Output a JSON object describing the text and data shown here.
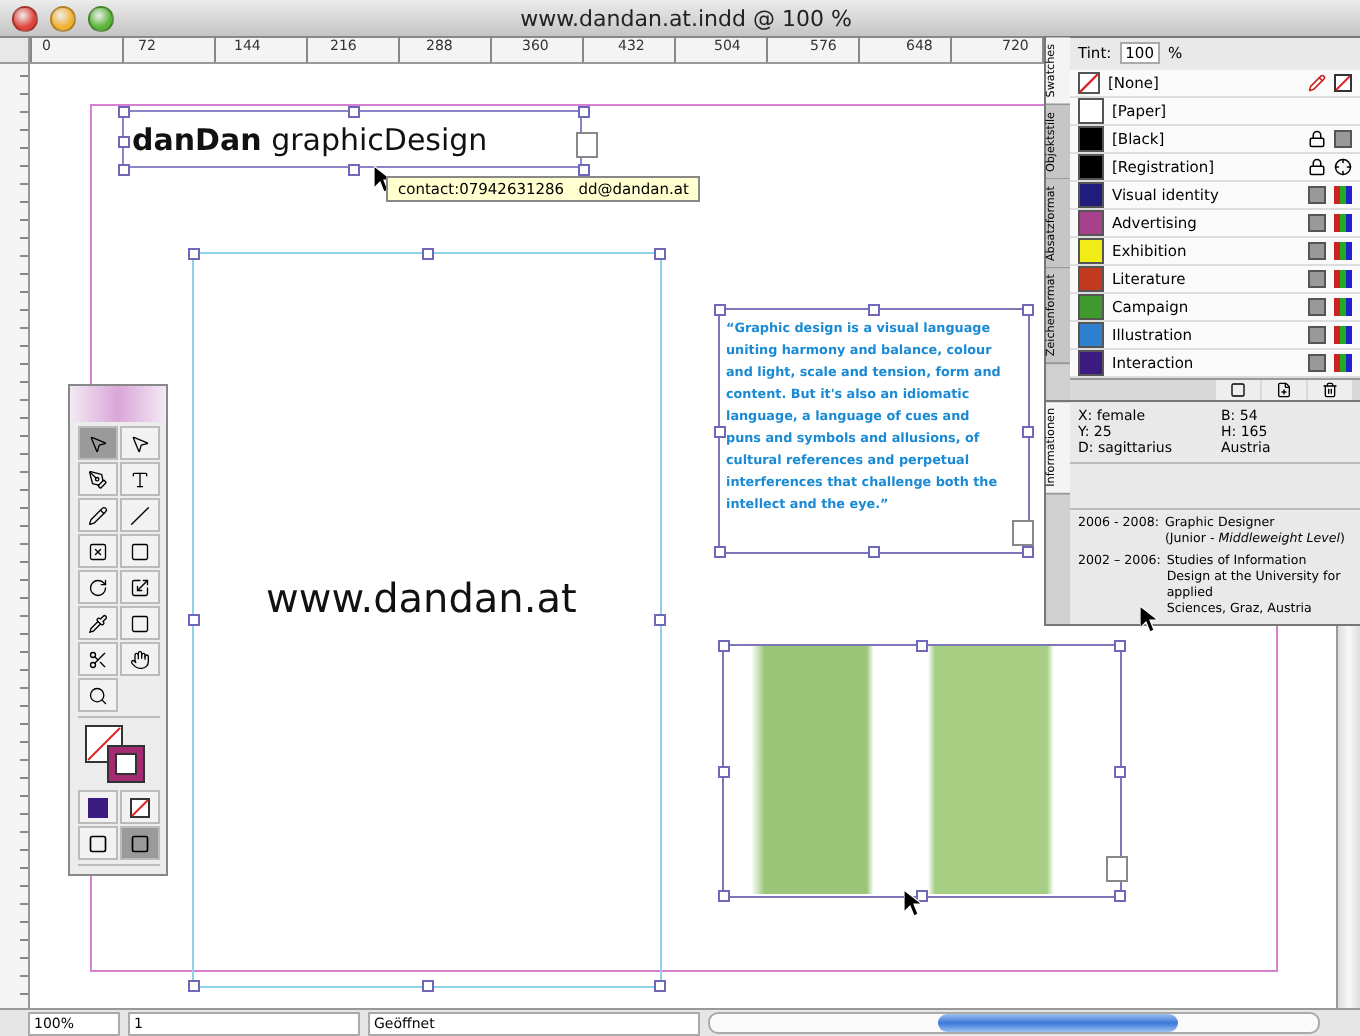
{
  "window": {
    "title": "www.dandan.at.indd @ 100 %"
  },
  "ruler": {
    "ticks": [
      "0",
      "72",
      "144",
      "216",
      "288",
      "360",
      "432",
      "504",
      "576",
      "648",
      "720"
    ]
  },
  "canvas": {
    "logo": "**danDan** graphicDesign",
    "tooltip": "contact:07942631286   dd@dandan.at",
    "url": "www.dandan.at",
    "quote": "“Graphic design is a visual language uniting harmony and balance, colour and light, scale and tension, form and content. But it's also an idiomatic language, a language of cues and puns and symbols and allusions, of cultural references and perpetual interferences that challenge both the intellect and the eye.”"
  },
  "swatches": {
    "tint_label": "Tint:",
    "tint": "100",
    "tint_unit": "%",
    "tabs": [
      {
        "label": "Swatches",
        "selected": true
      },
      {
        "label": "Objektstile",
        "selected": false
      },
      {
        "label": "Absatzformat",
        "selected": false
      },
      {
        "label": "Zeichenformat",
        "selected": false
      }
    ],
    "items": [
      {
        "kind": "none",
        "name": "[None]"
      },
      {
        "kind": "paper",
        "name": "[Paper]"
      },
      {
        "kind": "process",
        "name": "[Black]",
        "color": "#000000",
        "locked": true
      },
      {
        "kind": "registration",
        "name": "[Registration]",
        "color": "#000000",
        "locked": true
      },
      {
        "kind": "process",
        "name": "Visual identity",
        "color": "#1f1c7c",
        "locked": false
      },
      {
        "kind": "process",
        "name": "Advertising",
        "color": "#a8408c",
        "locked": false
      },
      {
        "kind": "process",
        "name": "Exhibition",
        "color": "#f2ec16",
        "locked": false
      },
      {
        "kind": "process",
        "name": "Literature",
        "color": "#c23a1e",
        "locked": false
      },
      {
        "kind": "process",
        "name": "Campaign",
        "color": "#3e9a2c",
        "locked": false
      },
      {
        "kind": "process",
        "name": "Illustration",
        "color": "#2e80cf",
        "locked": false
      },
      {
        "kind": "process",
        "name": "Interaction",
        "color": "#3b1a82",
        "locked": false
      }
    ]
  },
  "info": {
    "tab": {
      "label": "Informationen",
      "selected": true
    },
    "x": "X: female",
    "y": "Y: 25",
    "d": "D: sagittarius",
    "b": "B: 54",
    "h": "H: 165",
    "country": "Austria",
    "entries": [
      {
        "years": "2006 - 2008:",
        "lines": [
          "Graphic Designer",
          "(Junior - *Middleweight Level*)"
        ]
      },
      {
        "years": "2002 – 2006:",
        "lines": [
          "Studies of Information",
          "Design at the University for applied",
          "Sciences, Graz, Austria"
        ]
      }
    ]
  },
  "status_bar": {
    "zoom": "100%",
    "page": "1",
    "state": "Geöffnet"
  }
}
